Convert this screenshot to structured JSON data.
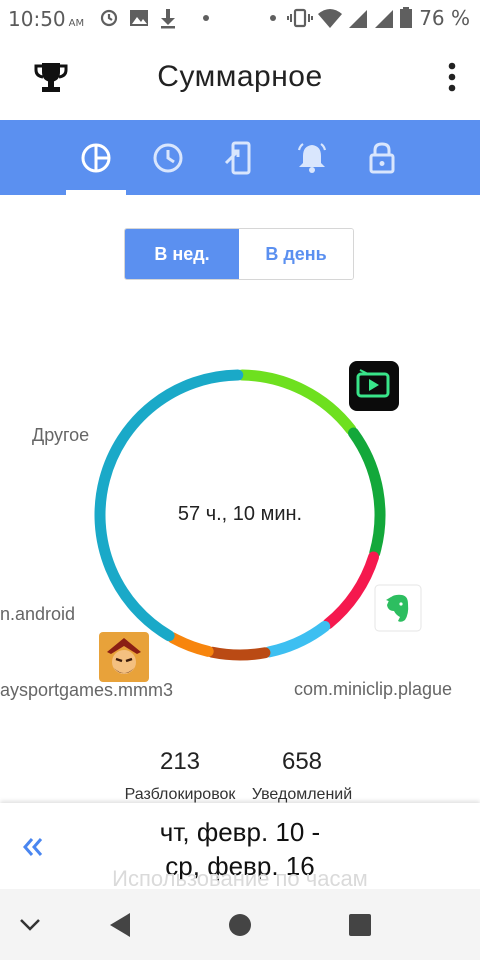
{
  "status_bar": {
    "time": "10:50",
    "ampm": "AM",
    "battery_percent": "76 %"
  },
  "app_bar": {
    "title": "Суммарное",
    "trophy_icon": "trophy-icon",
    "menu_icon": "more-vert-icon"
  },
  "tabs": [
    {
      "icon": "pie-chart-icon",
      "selected": true
    },
    {
      "icon": "clock-icon",
      "selected": false
    },
    {
      "icon": "phone-open-icon",
      "selected": false
    },
    {
      "icon": "bell-icon",
      "selected": false
    },
    {
      "icon": "lock-icon",
      "selected": false
    }
  ],
  "period_toggle": {
    "week_label": "В нед.",
    "day_label": "В день",
    "selected": "week"
  },
  "chart_data": {
    "type": "donut",
    "total_label": "57 ч., 10 мин.",
    "slices": [
      {
        "label": "",
        "share": 0.148,
        "color": "#6ee01f"
      },
      {
        "label": "",
        "share": 0.148,
        "color": "#13a83a"
      },
      {
        "label": "com.miniclip.plague",
        "share": 0.098,
        "color": "#f5194e"
      },
      {
        "label": "",
        "share": 0.075,
        "color": "#3dbff1"
      },
      {
        "label": "aysportgames.mmm3",
        "share": 0.065,
        "color": "#ba4a14"
      },
      {
        "label": "n.android",
        "share": 0.048,
        "color": "#f7850d"
      },
      {
        "label": "Другое",
        "share": 0.418,
        "color": "#1aa9c8"
      }
    ]
  },
  "stats": {
    "unlocks_value": "213",
    "unlocks_label": "Разблокировок",
    "notifications_value": "658",
    "notifications_label": "Уведомлений"
  },
  "date_range": {
    "line1": "чт, февр. 10 -",
    "line2": "ср, февр. 16",
    "back_icon": "double-chevron-left-icon"
  },
  "hourly_section_title": "Использование по часам",
  "colors": {
    "accent": "#5b90f0",
    "white": "#ffffff"
  }
}
